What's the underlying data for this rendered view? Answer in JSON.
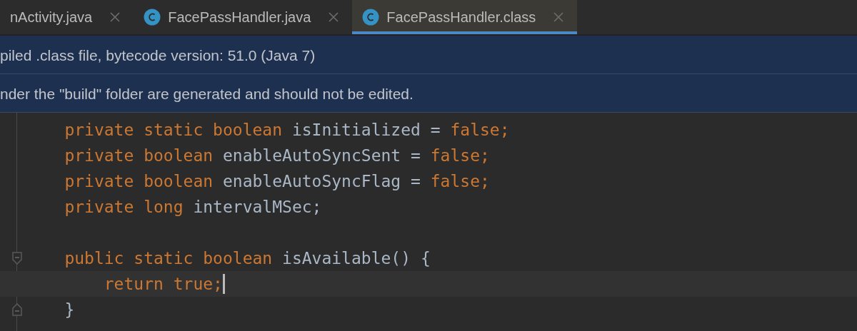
{
  "tabs": [
    {
      "label": "nActivity.java",
      "selected": false
    },
    {
      "label": "FacePassHandler.java",
      "selected": false
    },
    {
      "label": "FacePassHandler.class",
      "selected": true
    }
  ],
  "banners": [
    "piled .class file, bytecode version: 51.0 (Java 7)",
    "nder the \"build\" folder are generated and should not be edited."
  ],
  "code_lines": [
    {
      "kind": "code",
      "caret": false,
      "tokens": [
        {
          "kind": "keyword",
          "text": "    private static boolean "
        },
        {
          "kind": "plain",
          "text": "isInitialized = "
        },
        {
          "kind": "keyword",
          "text": "false;"
        }
      ]
    },
    {
      "kind": "code",
      "caret": false,
      "tokens": [
        {
          "kind": "keyword",
          "text": "    private boolean "
        },
        {
          "kind": "plain",
          "text": "enableAutoSyncSent = "
        },
        {
          "kind": "keyword",
          "text": "false;"
        }
      ]
    },
    {
      "kind": "code",
      "caret": false,
      "tokens": [
        {
          "kind": "keyword",
          "text": "    private boolean "
        },
        {
          "kind": "plain",
          "text": "enableAutoSyncFlag = "
        },
        {
          "kind": "keyword",
          "text": "false;"
        }
      ]
    },
    {
      "kind": "code",
      "caret": false,
      "tokens": [
        {
          "kind": "keyword",
          "text": "    private long "
        },
        {
          "kind": "plain",
          "text": "intervalMSec;"
        }
      ]
    },
    {
      "kind": "blank"
    },
    {
      "kind": "fold-start",
      "caret": false,
      "tokens": [
        {
          "kind": "keyword",
          "text": "    public static boolean "
        },
        {
          "kind": "plain",
          "text": "isAvailable() {"
        }
      ]
    },
    {
      "kind": "code",
      "caret": true,
      "tokens": [
        {
          "kind": "keyword",
          "text": "        return true;"
        }
      ]
    },
    {
      "kind": "fold-end",
      "caret": false,
      "tokens": [
        {
          "kind": "plain",
          "text": "    }"
        }
      ]
    }
  ]
}
